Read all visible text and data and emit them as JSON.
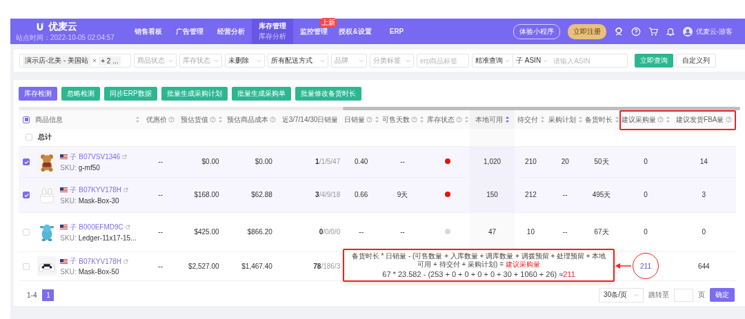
{
  "header": {
    "logo": "优麦云",
    "site_time": "站点时间：2022-10-05 02:04:57",
    "nav": [
      {
        "label": "销售看板",
        "selected": false
      },
      {
        "label": "广告管理",
        "selected": false
      },
      {
        "label": "经营分析",
        "selected": false
      },
      {
        "label": "库存管理",
        "sub": "库存分析",
        "selected": true
      },
      {
        "label": "监控管理",
        "badge": "上新",
        "selected": false
      },
      {
        "label": "授权&设置",
        "selected": false
      },
      {
        "label": "ERP",
        "selected": false
      }
    ],
    "trial_button": "体验小程序",
    "register_button": "立即注册",
    "user": "优麦云-游客"
  },
  "filters": {
    "store_tag": "演示店-北美 - 美国站",
    "more_tag": "+ 2 ...",
    "selects": [
      {
        "placeholder": "商品状态"
      },
      {
        "placeholder": "库存状态"
      },
      {
        "value": "未删除"
      },
      {
        "value": "所有配送方式"
      },
      {
        "placeholder": "品牌"
      },
      {
        "placeholder": "分类标签"
      }
    ],
    "erp_tag": {
      "placeholder": "erp商品标签"
    },
    "match_mode": "精准查询",
    "search_field": "子 ASIN",
    "search": {
      "placeholder": "请输入ASIN"
    },
    "query_button": "立即查询",
    "columns_button": "自定义列"
  },
  "actions": [
    {
      "label": "库存检测",
      "kind": "primary"
    },
    {
      "label": "忽略检测",
      "kind": "success"
    },
    {
      "label": "同步ERP数据",
      "kind": "success"
    },
    {
      "label": "批量生成采购计划",
      "kind": "success"
    },
    {
      "label": "批量生成采购单",
      "kind": "success"
    },
    {
      "label": "批量修改备货时长",
      "kind": "success"
    }
  ],
  "table": {
    "select_all": {
      "indeterminate": true
    },
    "product_column": {
      "label": "商品信息",
      "sortable": true
    },
    "columns": [
      {
        "label": "优惠价",
        "help": true,
        "sortable": false,
        "highlighted": false
      },
      {
        "label": "预估货值",
        "help": true,
        "sortable": true,
        "sorted": false,
        "highlighted": false
      },
      {
        "label": "预估商品成本",
        "help": true,
        "sortable": false,
        "highlighted": false
      },
      {
        "label": "近3/7/14/30日销量",
        "help": false,
        "sortable": false,
        "highlighted": false
      },
      {
        "label": "日销量",
        "help": true,
        "sortable": true,
        "sorted": false,
        "highlighted": false
      },
      {
        "label": "可售天数",
        "help": true,
        "sortable": true,
        "sorted": false,
        "highlighted": false
      },
      {
        "label": "库存状态",
        "help": true,
        "sortable": true,
        "sorted": false,
        "highlighted": false
      },
      {
        "label": "本地可用",
        "help": false,
        "sortable": true,
        "sorted": true,
        "highlighted": false
      },
      {
        "label": "待交付",
        "help": false,
        "sortable": true,
        "sorted": false,
        "highlighted": false
      },
      {
        "label": "采购计划",
        "help": false,
        "sortable": true,
        "sorted": false,
        "highlighted": false
      },
      {
        "label": "备货时长",
        "help": false,
        "sortable": true,
        "sorted": false,
        "highlighted": false
      },
      {
        "label": "建议采购量",
        "help": true,
        "sortable": true,
        "sorted": false,
        "highlighted": true
      },
      {
        "label": "建议发货FBA量",
        "help": true,
        "sortable": false,
        "highlighted": true
      }
    ],
    "total_row": {
      "checked": false,
      "label": "总计"
    },
    "rows": [
      {
        "selected": true,
        "asin_prefix": "子",
        "asin": "B07VSV1346",
        "sku_label": "SKU:",
        "sku": "g-mf50",
        "cells": [
          "--",
          "$0.00",
          "$0.00",
          "**1**/1/5/47",
          "0.40",
          "--",
          {
            "color": "#e8120c"
          },
          "1,020",
          "210",
          "20",
          "50天",
          "0",
          "14"
        ]
      },
      {
        "selected": true,
        "asin_prefix": "子",
        "asin": "B07KYV178H",
        "sku_label": "SKU:",
        "sku": "Mask-Box-30",
        "cells": [
          "--",
          "$168.00",
          "$62.88",
          "**3**/4/9/18",
          "0.66",
          "9天",
          {
            "color": "#e8120c"
          },
          "150",
          "212",
          "--",
          "495天",
          "0",
          "3"
        ]
      },
      {
        "selected": false,
        "asin_prefix": "子",
        "asin": "B000EFMD9C",
        "sku_label": "SKU:",
        "sku": "Ledger-11x17-15...",
        "cells": [
          "--",
          "$425.00",
          "$866.20",
          "**0**/0/0/0",
          "--",
          "--",
          {
            "color": "#d9d9d9"
          },
          "47",
          "10",
          "--",
          "67天",
          "0",
          "0"
        ]
      },
      {
        "selected": false,
        "asin_prefix": "子",
        "asin": "B07KYV178H",
        "sku_label": "SKU:",
        "sku": "Mask-Box-50",
        "cells": [
          "--",
          "$2,527.00",
          "$1,467.40",
          "**78**/186/3"
        ],
        "end_cells": [
          "211",
          "644"
        ],
        "circled_value": true
      }
    ]
  },
  "callout": {
    "formula": "备货时长 * 日销量 - (可售数量 + 入库数量 + 调库数量 + 调拨预留 + 处理预留 + 本地可用 + 待交付 + 采购计划) = ",
    "result_label": "建议采购量",
    "calculation": "67 * 23.582 - (253 + 0 + 0 + 0 + 0 + 30 + 1060 + 26) ≈",
    "result": "211"
  },
  "pagination": {
    "range": "1-4",
    "page": "1",
    "page_size": "30条/页",
    "jump_label": "跳转至",
    "page_unit": "页",
    "confirm": "确定"
  }
}
